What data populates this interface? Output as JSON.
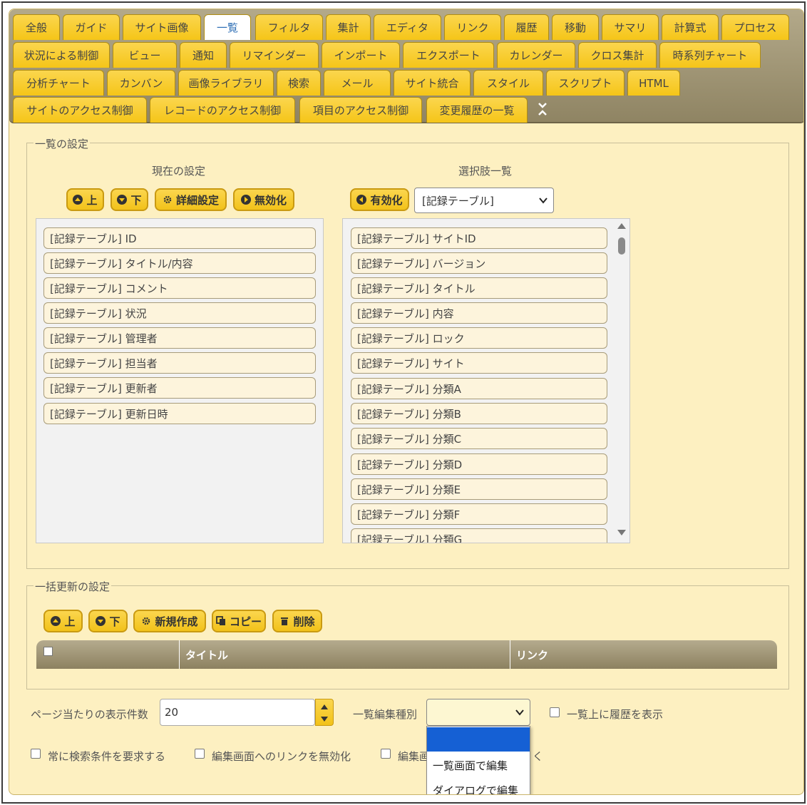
{
  "tabs": {
    "row1": [
      "全般",
      "ガイド",
      "サイト画像",
      "一覧",
      "フィルタ",
      "集計",
      "エディタ",
      "リンク",
      "履歴",
      "移動",
      "サマリ",
      "計算式",
      "プロセス"
    ],
    "row2": [
      "状況による制御",
      "ビュー",
      "通知",
      "リマインダー",
      "インポート",
      "エクスポート",
      "カレンダー",
      "クロス集計",
      "時系列チャート"
    ],
    "row3": [
      "分析チャート",
      "カンバン",
      "画像ライブラリ",
      "検索",
      "メール",
      "サイト統合",
      "スタイル",
      "スクリプト",
      "HTML"
    ],
    "row4": [
      "サイトのアクセス制御",
      "レコードのアクセス制御",
      "項目のアクセス制御",
      "変更履歴の一覧"
    ],
    "active": "一覧"
  },
  "list_settings": {
    "legend": "一覧の設定",
    "current_caption": "現在の設定",
    "options_caption": "選択肢一覧",
    "btn_up": "上",
    "btn_down": "下",
    "btn_detail": "詳細設定",
    "btn_disable": "無効化",
    "btn_enable": "有効化",
    "table_select_value": "[記録テーブル]",
    "current_items": [
      "[記録テーブル] ID",
      "[記録テーブル] タイトル/内容",
      "[記録テーブル] コメント",
      "[記録テーブル] 状況",
      "[記録テーブル] 管理者",
      "[記録テーブル] 担当者",
      "[記録テーブル] 更新者",
      "[記録テーブル] 更新日時"
    ],
    "option_items": [
      "[記録テーブル] サイトID",
      "[記録テーブル] バージョン",
      "[記録テーブル] タイトル",
      "[記録テーブル] 内容",
      "[記録テーブル] ロック",
      "[記録テーブル] サイト",
      "[記録テーブル] 分類A",
      "[記録テーブル] 分類B",
      "[記録テーブル] 分類C",
      "[記録テーブル] 分類D",
      "[記録テーブル] 分類E",
      "[記録テーブル] 分類F",
      "[記録テーブル] 分類G"
    ]
  },
  "bulk_update": {
    "legend": "一括更新の設定",
    "btn_up": "上",
    "btn_down": "下",
    "btn_new": "新規作成",
    "btn_copy": "コピー",
    "btn_delete": "削除",
    "col_title": "タイトル",
    "col_link": "リンク"
  },
  "bottom": {
    "page_size_label": "ページ当たりの表示件数",
    "page_size_value": "20",
    "edit_type_label": "一覧編集種別",
    "edit_type_options": [
      "",
      "一覧画面で編集",
      "ダイアログで編集"
    ],
    "history_label": "一覧上に履歴を表示",
    "require_search_label": "常に検索条件を要求する",
    "disable_link_label": "編集画面へのリンクを無効化",
    "partial_label": "編集画",
    "partial_trailing": "く"
  },
  "colors": {
    "panel_bg": "#fdf0c1",
    "tab_yellow": "#f5c518",
    "tabbar_brown": "#8f8463",
    "highlight_blue": "#1560d4"
  }
}
